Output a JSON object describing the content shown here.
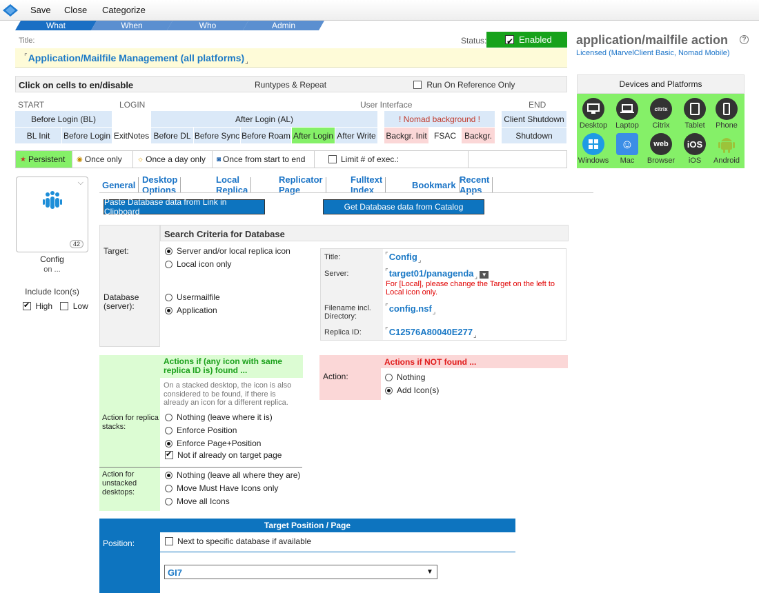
{
  "toolbar": {
    "save": "Save",
    "close": "Close",
    "categorize": "Categorize"
  },
  "wizard": {
    "tabs": [
      "What",
      "When",
      "Who",
      "Admin"
    ],
    "active": "What"
  },
  "title_caption": "Title:",
  "status": {
    "caption": "Status:",
    "value": "Enabled",
    "checked": true
  },
  "title_value": "Application/Mailfile Management (all platforms)",
  "side": {
    "title": "application/mailfile action",
    "license": "Licensed (MarvelClient Basic, Nomad Mobile)"
  },
  "runtypes": {
    "hint": "Click on cells to en/disable",
    "section": "Runtypes & Repeat",
    "run_on_reference": "Run On Reference Only",
    "groups": {
      "start": "START",
      "login": "LOGIN",
      "ui": "User Interface",
      "end": "END"
    },
    "row1": {
      "before_login_bl": "Before Login (BL)",
      "after_login_al": "After Login (AL)",
      "nomad_bg": "! Nomad background !",
      "client_shutdown": "Client Shutdown"
    },
    "row2": [
      "BL Init",
      "Before Login",
      "ExitNotes",
      "Before DL",
      "Before Sync",
      "Before Roam",
      "After Login",
      "After Write",
      "Backgr. Init",
      "FSAC",
      "Backgr.",
      "Shutdown"
    ]
  },
  "persist": {
    "persistent": "Persistent",
    "once_only": "Once only",
    "once_day": "Once a day only",
    "once_start_end": "Once from start to end",
    "limit": "Limit # of exec.:"
  },
  "devices": {
    "header": "Devices and Platforms",
    "items": [
      {
        "label": "Desktop",
        "glyph": "▭"
      },
      {
        "label": "Laptop",
        "glyph": "▭"
      },
      {
        "label": "Citrix",
        "glyph": "citrix"
      },
      {
        "label": "Tablet",
        "glyph": "▯"
      },
      {
        "label": "Phone",
        "glyph": "▯"
      },
      {
        "label": "Windows",
        "glyph": "⊞"
      },
      {
        "label": "Mac",
        "glyph": "☺"
      },
      {
        "label": "Browser",
        "glyph": "web"
      },
      {
        "label": "iOS",
        "glyph": "iOS"
      },
      {
        "label": "Android",
        "glyph": "◆"
      }
    ]
  },
  "icon_card": {
    "count": "42",
    "name": "Config",
    "sub": "on ...",
    "include_label": "Include Icon(s)",
    "high": "High",
    "low": "Low"
  },
  "cfg_tabs": [
    "General",
    "Desktop Options",
    "Local Replica",
    "Replicator Page",
    "Fulltext Index",
    "Bookmark",
    "Recent Apps"
  ],
  "buttons": {
    "paste": "Paste Database data from Link in Clipboard",
    "catalog": "Get Database data from Catalog"
  },
  "search": {
    "title": "Search Criteria for Database",
    "target_label": "Target:",
    "target_opts": [
      "Server and/or local replica icon",
      "Local icon only"
    ],
    "db_label": "Database (server):",
    "db_opts": [
      "Usermailfile",
      "Application"
    ]
  },
  "db": {
    "title_label": "Title:",
    "title_value": "Config",
    "server_label": "Server:",
    "server_value": "target01/panagenda",
    "server_warning": "For [Local], please change the Target on the left to Local icon only.",
    "filename_label": "Filename incl. Directory:",
    "filename_value": "config.nsf",
    "replica_label": "Replica ID:",
    "replica_value": "C12576A80040E277"
  },
  "found": {
    "title": "Actions if (any icon with same replica ID is) found ...",
    "note": "On a stacked desktop, the icon is also considered to be found, if there is already an icon for a different replica.",
    "stack_label": "Action for replica stacks:",
    "stack_opts": [
      "Nothing (leave where it is)",
      "Enforce Position",
      "Enforce Page+Position"
    ],
    "not_on_target": "Not if already on target page",
    "unstacked_label": "Action for unstacked desktops:",
    "unstacked_opts": [
      "Nothing (leave all where they are)",
      "Move Must Have Icons only",
      "Move all Icons"
    ]
  },
  "not_found": {
    "title": "Actions if NOT found ...",
    "action_label": "Action:",
    "opts": [
      "Nothing",
      "Add Icon(s)"
    ]
  },
  "target_pos": {
    "title": "Target Position / Page",
    "position_label": "Position:",
    "next_to": "Next to specific database if available",
    "page_value": "GI7"
  },
  "colors": {
    "accent_blue": "#0d74bf",
    "enabled_green": "#17a21b",
    "cell_green": "#85f068",
    "cell_pink": "#fbd7d7",
    "title_bg": "#fefbd8"
  }
}
